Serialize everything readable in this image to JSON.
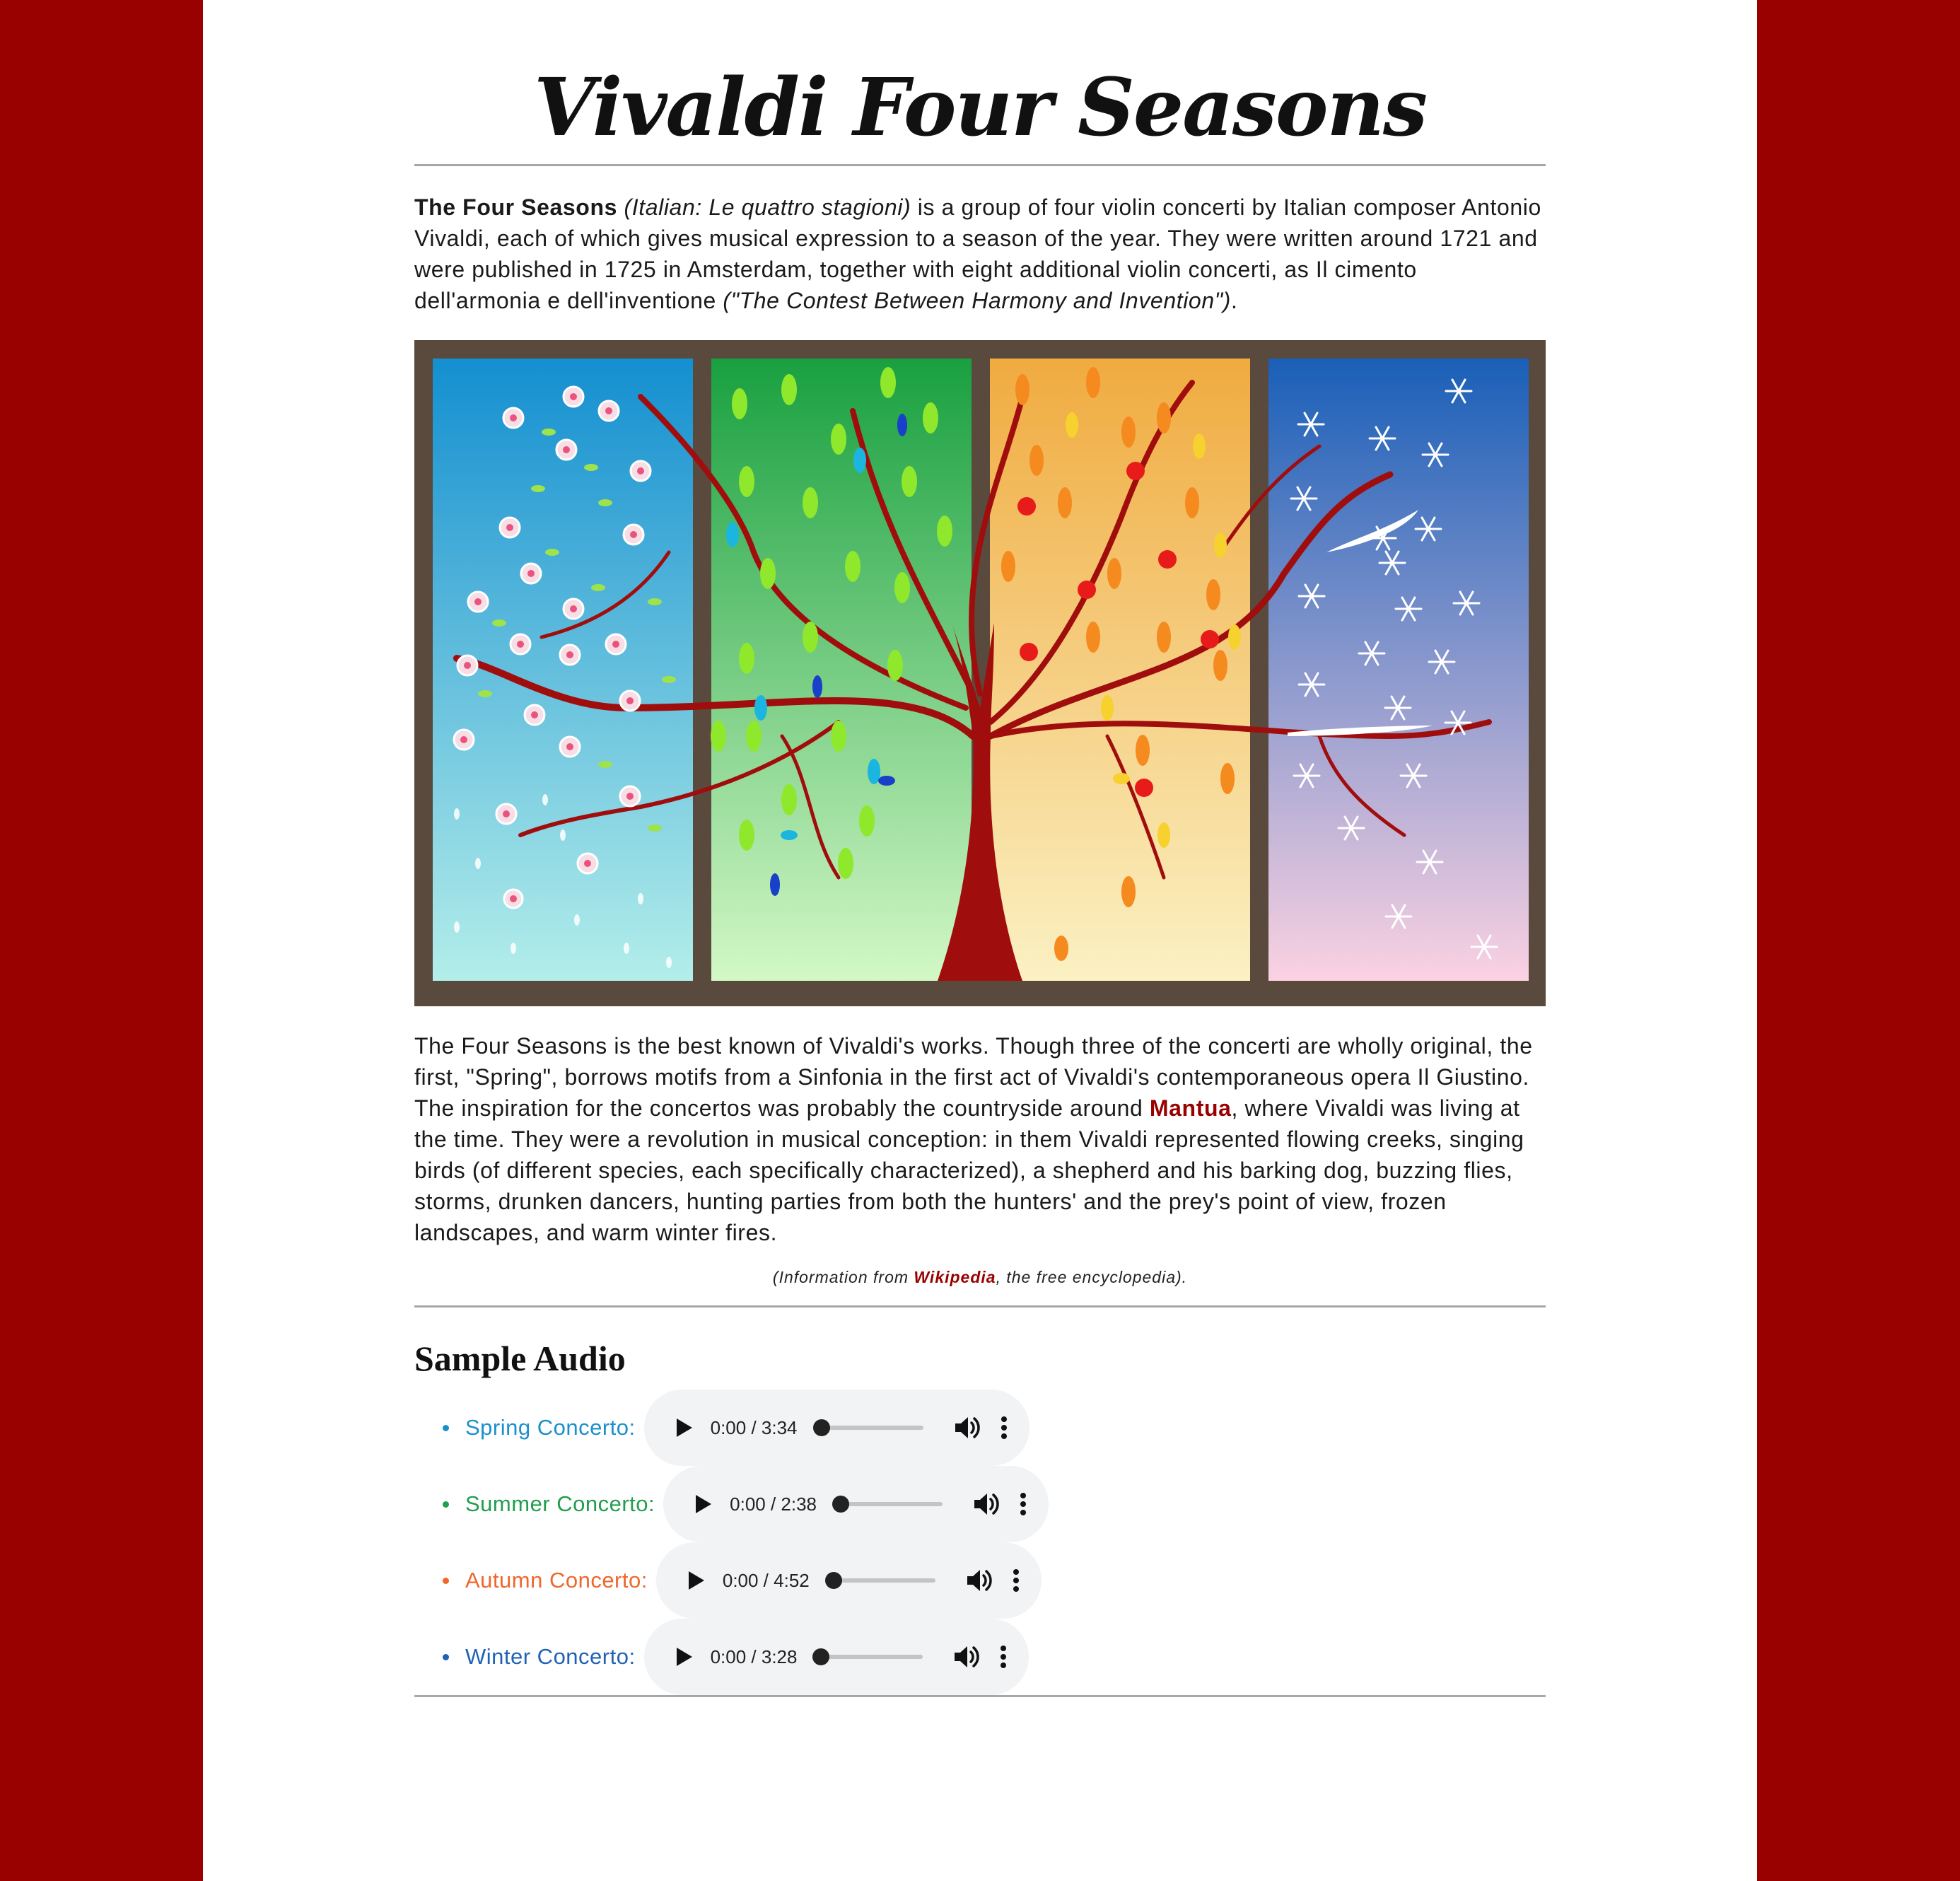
{
  "title": "Vivaldi Four Seasons",
  "intro": {
    "bold": "The Four Seasons",
    "italic1": "(Italian: Le quattro stagioni)",
    "text1": " is a group of four violin concerti by Italian composer Antonio Vivaldi, each of which gives musical expression to a season of the year. They were written around 1721 and were published in 1725 in Amsterdam, together with eight additional violin concerti, as Il cimento dell'armonia e dell'inventione ",
    "italic2": "(\"The Contest Between Harmony and Invention\")",
    "text2": "."
  },
  "body": {
    "text1": "The Four Seasons is the best known of Vivaldi's works. Though three of the concerti are wholly original, the first, \"Spring\", borrows motifs from a Sinfonia in the first act of Vivaldi's contemporaneous opera Il Giustino. The inspiration for the concertos was probably the countryside around ",
    "link": "Mantua",
    "text2": ", where Vivaldi was living at the time. They were a revolution in musical conception: in them Vivaldi represented flowing creeks, singing birds (of different species, each specifically characterized), a shepherd and his barking dog, buzzing flies, storms, drunken dancers, hunting parties from both the hunters' and the prey's point of view, frozen landscapes, and warm winter fires."
  },
  "credit": {
    "before": "(Information from ",
    "link": "Wikipedia",
    "after": ", the free encyclopedia)."
  },
  "audio_heading": "Sample Audio",
  "tracks": [
    {
      "label": "Spring Concerto:",
      "time": "0:00 / 3:34",
      "color": "#1b8fcc"
    },
    {
      "label": "Summer Concerto:",
      "time": "0:00 / 2:38",
      "color": "#1f9e4c"
    },
    {
      "label": "Autumn Concerto:",
      "time": "0:00 / 4:52",
      "color": "#f0662b"
    },
    {
      "label": "Winter Concerto:",
      "time": "0:00 / 3:28",
      "color": "#1f62b5"
    }
  ],
  "colors": {
    "background": "#990000",
    "link": "#990000"
  }
}
